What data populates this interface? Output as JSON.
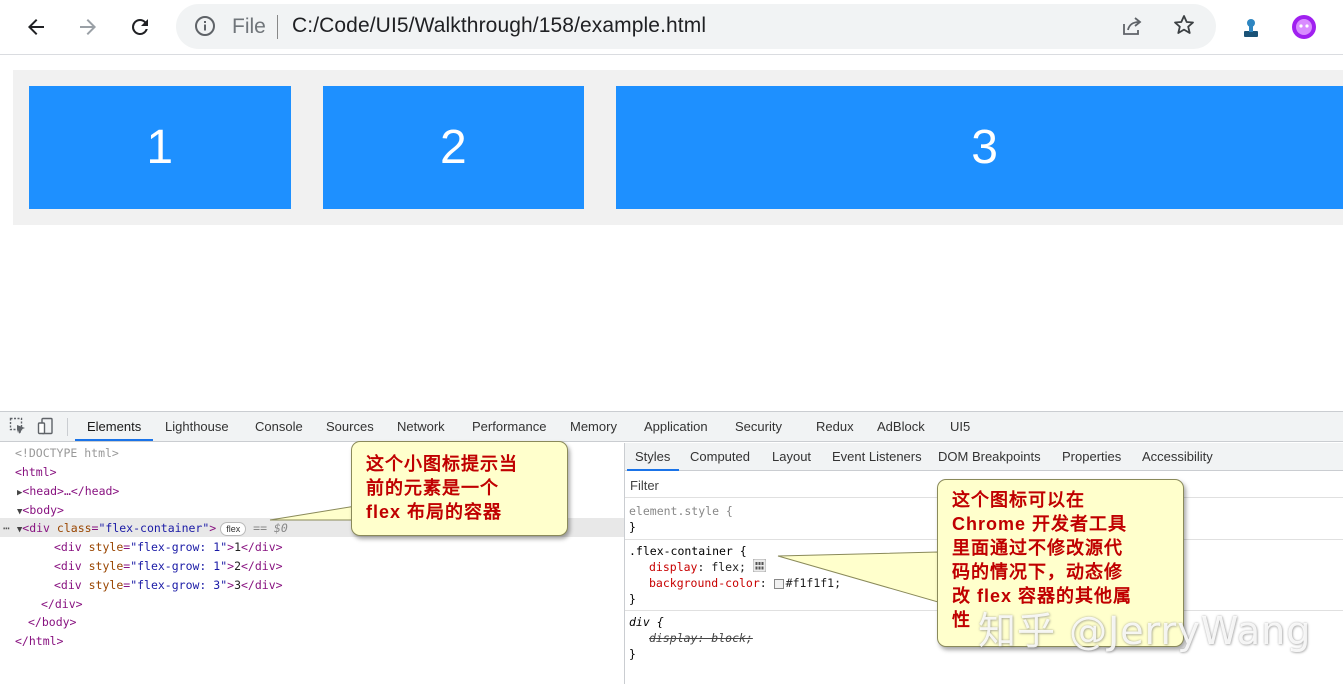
{
  "browser": {
    "scheme_label": "File",
    "url": "C:/Code/UI5/Walkthrough/158/example.html"
  },
  "page": {
    "items": [
      "1",
      "2",
      "3"
    ]
  },
  "devtools": {
    "tabs": [
      "Elements",
      "Lighthouse",
      "Console",
      "Sources",
      "Network",
      "Performance",
      "Memory",
      "Application",
      "Security",
      "Redux",
      "AdBlock",
      "UI5"
    ],
    "active_tab": "Elements",
    "dom": {
      "doctype": "<!DOCTYPE html>",
      "html_open": "<html>",
      "head": "<head>…</head>",
      "body_open": "<body>",
      "div_open_tag": "<div",
      "div_class_attr": "class",
      "div_class_val": "\"flex-container\"",
      "flex_badge": "flex",
      "eq_zero": "== $0",
      "children": [
        {
          "style": "\"flex-grow: 1\"",
          "text": "1"
        },
        {
          "style": "\"flex-grow: 1\"",
          "text": "2"
        },
        {
          "style": "\"flex-grow: 3\"",
          "text": "3"
        }
      ],
      "div_close": "</div>",
      "body_close": "</body>",
      "html_close": "</html>"
    },
    "styles_tabs": [
      "Styles",
      "Computed",
      "Layout",
      "Event Listeners",
      "DOM Breakpoints",
      "Properties",
      "Accessibility"
    ],
    "filter_placeholder": "Filter",
    "rules": {
      "element_style": "element.style {",
      "close_brace": "}",
      "flex_container_selector": ".flex-container {",
      "display_prop": "display",
      "display_val": "flex;",
      "bg_prop": "background-color",
      "bg_val": "#f1f1f1;",
      "div_selector": "div {",
      "div_display_strike": "display: block;"
    }
  },
  "annotations": {
    "callout_left": [
      "这个小图标提示当",
      "前的元素是一个",
      "flex 布局的容器"
    ],
    "callout_right": [
      "这个图标可以在",
      "Chrome 开发者工具",
      "里面通过不修改源代",
      "码的情况下，动态修",
      "改 flex 容器的其他属",
      "性"
    ],
    "watermark": "知乎 @JerryWang"
  },
  "colors": {
    "flex_item": "#1e90ff",
    "flex_container_bg": "#f1f1f1",
    "callout_bg": "#ffffcc",
    "callout_text": "#c00000",
    "devtools_accent": "#1a73e8"
  }
}
